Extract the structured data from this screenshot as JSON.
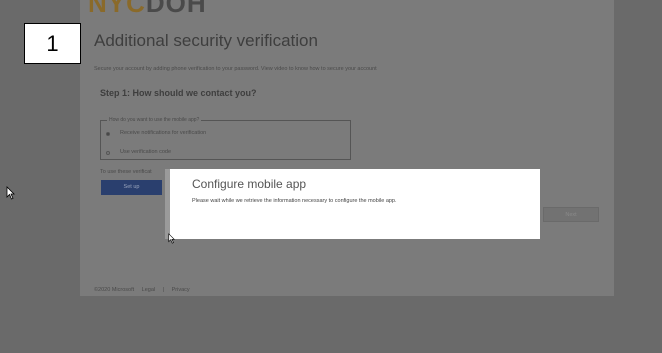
{
  "step_number": "1",
  "page": {
    "logo": "",
    "title": "Additional security verification",
    "description": "Secure your account by adding phone verification to your password. View video to know how to secure your account",
    "step_title": "Step 1: How should we contact you?",
    "fieldset_legend": "How do you want to use the mobile app?",
    "options": [
      {
        "label": "Receive notifications for verification",
        "checked": true
      },
      {
        "label": "Use verification code",
        "checked": false
      }
    ],
    "use_text": "To use these verificat",
    "setup_label": "Set up",
    "next_label": "Next"
  },
  "footer": {
    "copyright": "©2020 Microsoft",
    "legal": "Legal",
    "separator": "|",
    "privacy": "Privacy"
  },
  "modal": {
    "title": "Configure mobile app",
    "text": "Please wait while we retrieve the information necessary to configure the mobile app."
  }
}
